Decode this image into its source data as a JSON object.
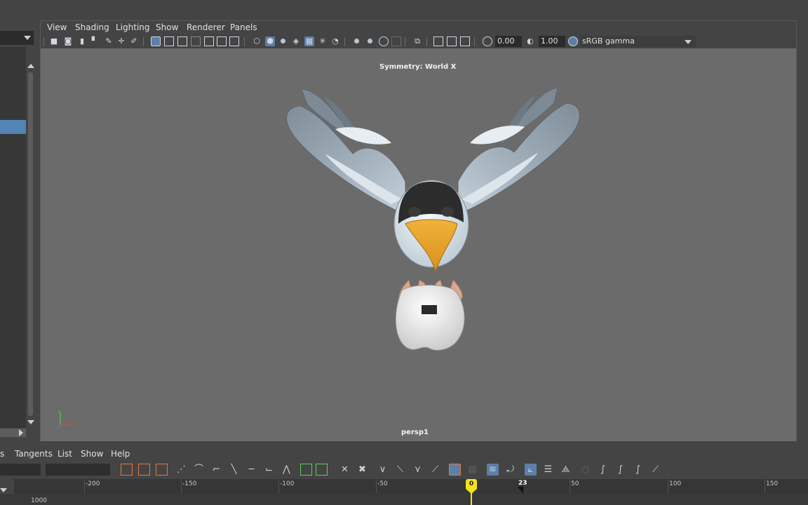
{
  "viewport_menu": [
    "View",
    "Shading",
    "Lighting",
    "Show",
    "Renderer",
    "Panels"
  ],
  "toolbar": {
    "exposure_value": "0.00",
    "gamma_value": "1.00",
    "color_space": "sRGB gamma"
  },
  "viewport": {
    "symmetry_label": "Symmetry: World X",
    "camera_label": "persp1",
    "axis_labels": [
      "y",
      "x",
      "z"
    ]
  },
  "graph_menu": [
    "s",
    "Tangents",
    "List",
    "Show",
    "Help"
  ],
  "graph": {
    "x_ticks": [
      "-200",
      "-150",
      "-100",
      "-50",
      "0",
      "50",
      "100",
      "150"
    ],
    "y_label": "1000",
    "current_frame": "0",
    "end_frame": "23"
  },
  "colors": {
    "viewport_bg": "#6b6b6b",
    "selection": "#5284b5",
    "playhead": "#f4e21a",
    "active_button": "#5d7fa8"
  }
}
